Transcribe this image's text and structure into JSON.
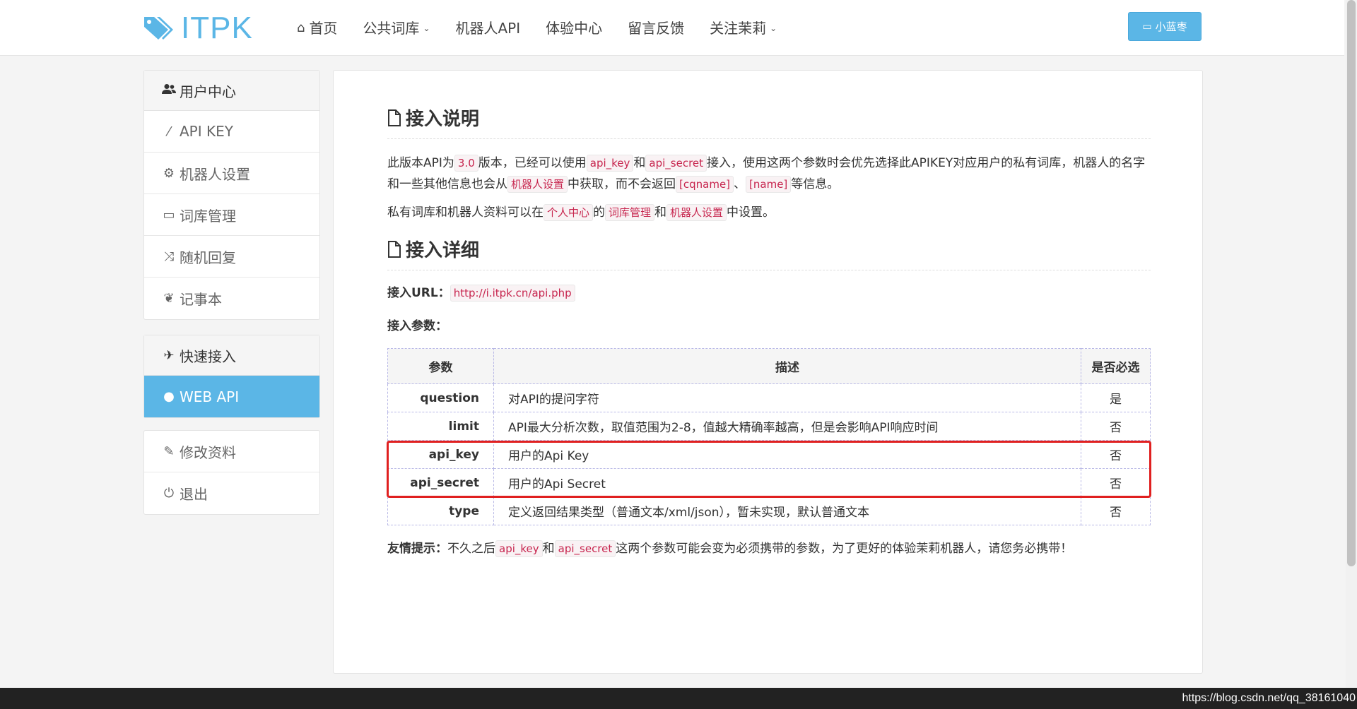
{
  "header": {
    "logo_text": "ITPK",
    "nav": [
      {
        "label": "首页",
        "caret": false,
        "home": true
      },
      {
        "label": "公共词库",
        "caret": true,
        "home": false
      },
      {
        "label": "机器人API",
        "caret": false,
        "home": false
      },
      {
        "label": "体验中心",
        "caret": false,
        "home": false
      },
      {
        "label": "留言反馈",
        "caret": false,
        "home": false
      },
      {
        "label": "关注茉莉",
        "caret": true,
        "home": false
      }
    ],
    "user_button": "小蓝枣",
    "accent": "#5bb6e6"
  },
  "sidebar": {
    "user_center": {
      "title": "用户中心",
      "items": [
        {
          "label": "API KEY",
          "icon": "magic-wand-icon"
        },
        {
          "label": "机器人设置",
          "icon": "gear-icon"
        },
        {
          "label": "词库管理",
          "icon": "credit-card-icon"
        },
        {
          "label": "随机回复",
          "icon": "shuffle-icon"
        },
        {
          "label": "记事本",
          "icon": "leaf-icon"
        }
      ]
    },
    "quick_access": {
      "title": "快速接入",
      "items": [
        {
          "label": "WEB API",
          "icon": "globe-icon",
          "active": true
        }
      ]
    },
    "account": {
      "items": [
        {
          "label": "修改资料",
          "icon": "edit-icon"
        },
        {
          "label": "退出",
          "icon": "power-icon"
        }
      ]
    }
  },
  "main": {
    "section1_title": "接入说明",
    "p1": {
      "t1": "此版本API为",
      "c1": "3.0",
      "t2": "版本，已经可以使用",
      "c2": "api_key",
      "t3": "和",
      "c3": "api_secret",
      "t4": "接入，使用这两个参数时会优先选择此APIKEY对应用户的私有词库，机器人的名字和一些其他信息也会从",
      "c4": "机器人设置",
      "t5": "中获取，而不会返回",
      "c5": "[cqname]",
      "t6": "、",
      "c6": "[name]",
      "t7": "等信息。"
    },
    "p2": {
      "t1": "私有词库和机器人资料可以在",
      "c1": "个人中心",
      "t2": "的",
      "c2": "词库管理",
      "t3": "和",
      "c3": "机器人设置",
      "t4": "中设置。"
    },
    "section2_title": "接入详细",
    "url_label": "接入URL：",
    "url_value": "http://i.itpk.cn/api.php",
    "params_label": "接入参数：",
    "table": {
      "headers": [
        "参数",
        "描述",
        "是否必选"
      ],
      "rows": [
        {
          "name": "question",
          "desc": "对API的提问字符",
          "required": "是"
        },
        {
          "name": "limit",
          "desc": "API最大分析次数，取值范围为2-8，值越大精确率越高，但是会影响API响应时间",
          "required": "否"
        },
        {
          "name": "api_key",
          "desc": "用户的Api Key",
          "required": "否"
        },
        {
          "name": "api_secret",
          "desc": "用户的Api Secret",
          "required": "否"
        },
        {
          "name": "type",
          "desc": "定义返回结果类型（普通文本/xml/json），暂未实现，默认普通文本",
          "required": "否"
        }
      ]
    },
    "tip": {
      "label": "友情提示：",
      "t1": "不久之后",
      "c1": "api_key",
      "t2": "和",
      "c2": "api_secret",
      "t3": "这两个参数可能会变为必须携带的参数，为了更好的体验茉莉机器人，请您务必携带！"
    }
  },
  "watermark": "https://blog.csdn.net/qq_38161040"
}
